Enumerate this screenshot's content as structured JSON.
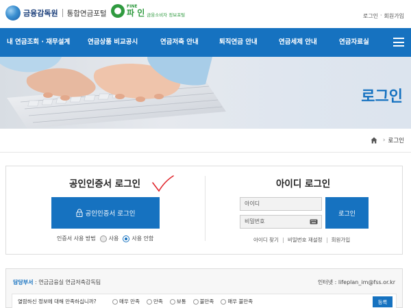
{
  "header": {
    "fss_name": "금융감독원",
    "portal_name": "통합연금포털",
    "fine_small": "FINE",
    "fine_main": "파 인",
    "fine_sub": "금융소비자 정보포털",
    "util_login": "로그인",
    "util_dot": "·",
    "util_join": "회원가입"
  },
  "gnb": {
    "items": [
      "내 연금조회 · 재무설계",
      "연금상품 비교공시",
      "연금저축 안내",
      "퇴직연금 안내",
      "연금세제 안내",
      "연금자료실"
    ]
  },
  "hero": {
    "title": "로그인"
  },
  "breadcrumb": {
    "current": "로그인",
    "separator": "›"
  },
  "cert_login": {
    "title": "공인인증서 로그인",
    "button_label": "공인인증서 로그인",
    "option_label": "인증서 사용 방법",
    "option_no": "사용",
    "option_yes": "사용 안함"
  },
  "id_login": {
    "title": "아이디 로그인",
    "id_placeholder": "아이디",
    "pw_placeholder": "비밀번호",
    "button_label": "로그인",
    "find_id": "아이디 찾기",
    "reset_pw": "비밀번호 재설정",
    "join": "회원가입"
  },
  "info": {
    "dept_label": "담당부서",
    "dept_value": " : 연금금융실 연금저축감독팀",
    "contact": "인터넷 : lifeplan_im@fss.or.kr",
    "survey_question": "열람하신 정보에 대해 만족하십니까?",
    "survey_options": [
      "매우 만족",
      "만족",
      "보통",
      "불만족",
      "매우 불만족"
    ],
    "submit_label": "등록"
  },
  "colors": {
    "primary": "#1672c0",
    "annotation": "#e0242b"
  }
}
